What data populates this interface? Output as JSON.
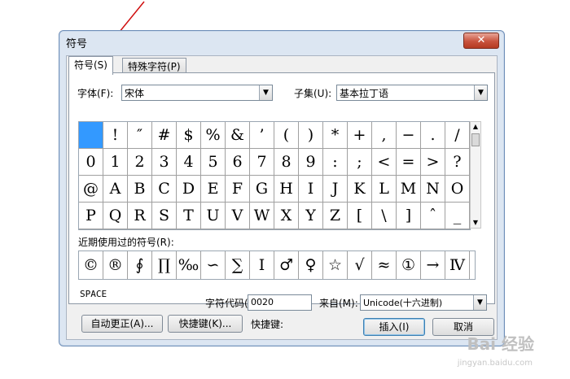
{
  "window": {
    "title": "符号",
    "close_label": "✕"
  },
  "tabs": [
    {
      "label": "符号(S)"
    },
    {
      "label": "特殊字符(P)"
    }
  ],
  "font": {
    "label": "字体(F):",
    "value": "宋体"
  },
  "subset": {
    "label": "子集(U):",
    "value": "基本拉丁语"
  },
  "symbol_grid": [
    [
      "",
      "!",
      "″",
      "#",
      "$",
      "%",
      "&",
      "’",
      "(",
      ")",
      "*",
      "+",
      ",",
      "−",
      ".",
      "/"
    ],
    [
      "0",
      "1",
      "2",
      "3",
      "4",
      "5",
      "6",
      "7",
      "8",
      "9",
      ":",
      ";",
      "<",
      "=",
      ">",
      "?"
    ],
    [
      "@",
      "A",
      "B",
      "C",
      "D",
      "E",
      "F",
      "G",
      "H",
      "I",
      "J",
      "K",
      "L",
      "M",
      "N",
      "O"
    ],
    [
      "P",
      "Q",
      "R",
      "S",
      "T",
      "U",
      "V",
      "W",
      "X",
      "Y",
      "Z",
      "[",
      "\\",
      "]",
      "ˆ",
      "_"
    ]
  ],
  "selected_symbol_index": 0,
  "recent": {
    "label": "近期使用过的符号(R):",
    "symbols": [
      "©",
      "®",
      "∮",
      "∏",
      "‰",
      "∽",
      "∑",
      "Ⅰ",
      "♂",
      "♀",
      "☆",
      "√",
      "≈",
      "①",
      "→",
      "Ⅳ"
    ]
  },
  "char_name": "SPACE",
  "char_code": {
    "label": "字符代码(C):",
    "value": "0020"
  },
  "from": {
    "label": "来自(M):",
    "value": "Unicode(十六进制)"
  },
  "autocorrect_button": "自动更正(A)...",
  "shortcut_button": "快捷键(K)...",
  "shortcut_label": "快捷键:",
  "insert_button": "插入(I)",
  "cancel_button": "取消",
  "watermark": {
    "main": "Bai 经验",
    "sub": "jingyan.baidu.com"
  },
  "colors": {
    "selection": "#3399ff",
    "arrow": "#d01010"
  }
}
